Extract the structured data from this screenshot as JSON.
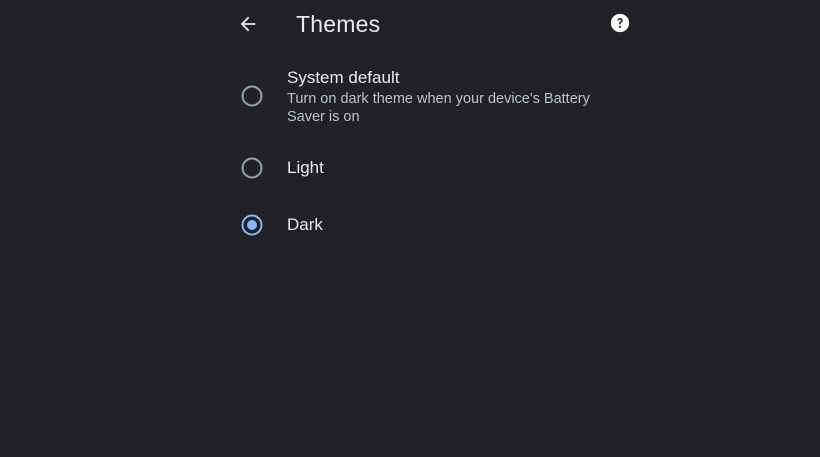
{
  "header": {
    "title": "Themes",
    "back_icon": "arrow-back-icon",
    "help_icon": "help-circle-icon"
  },
  "options": [
    {
      "label": "System default",
      "description": "Turn on dark theme when your device's Battery Saver is on",
      "selected": false
    },
    {
      "label": "Light",
      "selected": false
    },
    {
      "label": "Dark",
      "selected": true
    }
  ],
  "colors": {
    "background": "#202124",
    "text_primary": "#e8eaed",
    "text_secondary": "#bdc1c6",
    "radio_unselected": "#9aa0a6",
    "accent": "#8ab4f8"
  }
}
